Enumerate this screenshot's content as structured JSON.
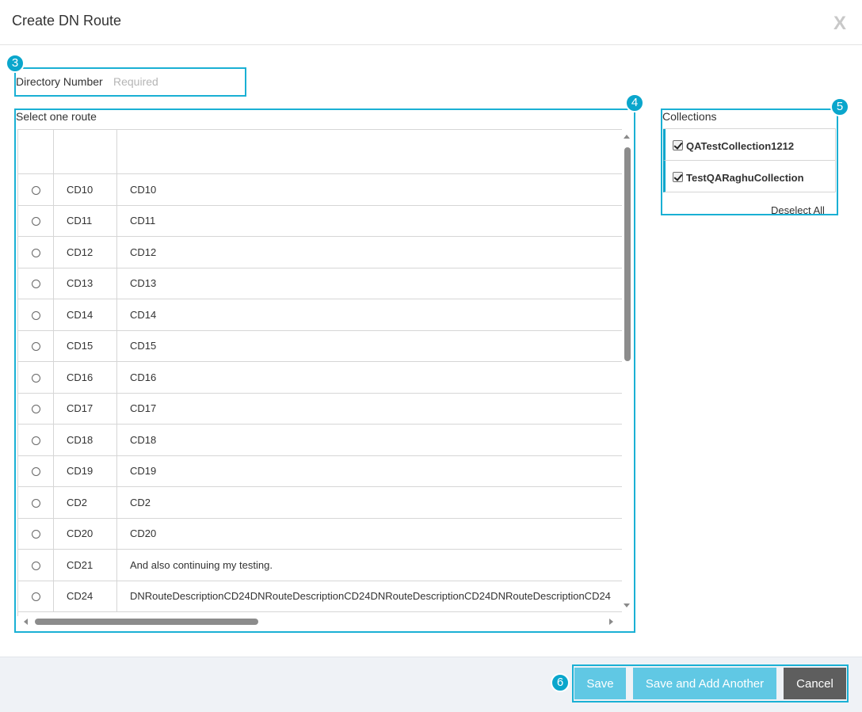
{
  "dialog": {
    "title": "Create DN Route",
    "close_glyph": "X"
  },
  "callouts": [
    "3",
    "4",
    "5",
    "6"
  ],
  "directory_number": {
    "label": "Directory Number",
    "placeholder": "Required",
    "value": ""
  },
  "route_section": {
    "label": "Select one route",
    "rows": [
      {
        "name": "CD10",
        "description": "CD10"
      },
      {
        "name": "CD11",
        "description": "CD11"
      },
      {
        "name": "CD12",
        "description": "CD12"
      },
      {
        "name": "CD13",
        "description": "CD13"
      },
      {
        "name": "CD14",
        "description": "CD14"
      },
      {
        "name": "CD15",
        "description": "CD15"
      },
      {
        "name": "CD16",
        "description": "CD16"
      },
      {
        "name": "CD17",
        "description": "CD17"
      },
      {
        "name": "CD18",
        "description": "CD18"
      },
      {
        "name": "CD19",
        "description": "CD19"
      },
      {
        "name": "CD2",
        "description": "CD2"
      },
      {
        "name": "CD20",
        "description": "CD20"
      },
      {
        "name": "CD21",
        "description": "And also continuing my testing."
      },
      {
        "name": "CD24",
        "description": "DNRouteDescriptionCD24DNRouteDescriptionCD24DNRouteDescriptionCD24DNRouteDescriptionCD24"
      }
    ]
  },
  "collections": {
    "label": "Collections",
    "items": [
      {
        "label": "QATestCollection1212",
        "checked": true
      },
      {
        "label": "TestQARaghuCollection",
        "checked": true
      }
    ],
    "deselect_all": "Deselect All"
  },
  "footer": {
    "save": "Save",
    "save_and_add": "Save and Add Another",
    "cancel": "Cancel"
  },
  "colors": {
    "accent": "#0aa6cc",
    "primary_button": "#60c8e4",
    "cancel_button": "#5e5e5e",
    "footer_bg": "#eff2f6"
  }
}
